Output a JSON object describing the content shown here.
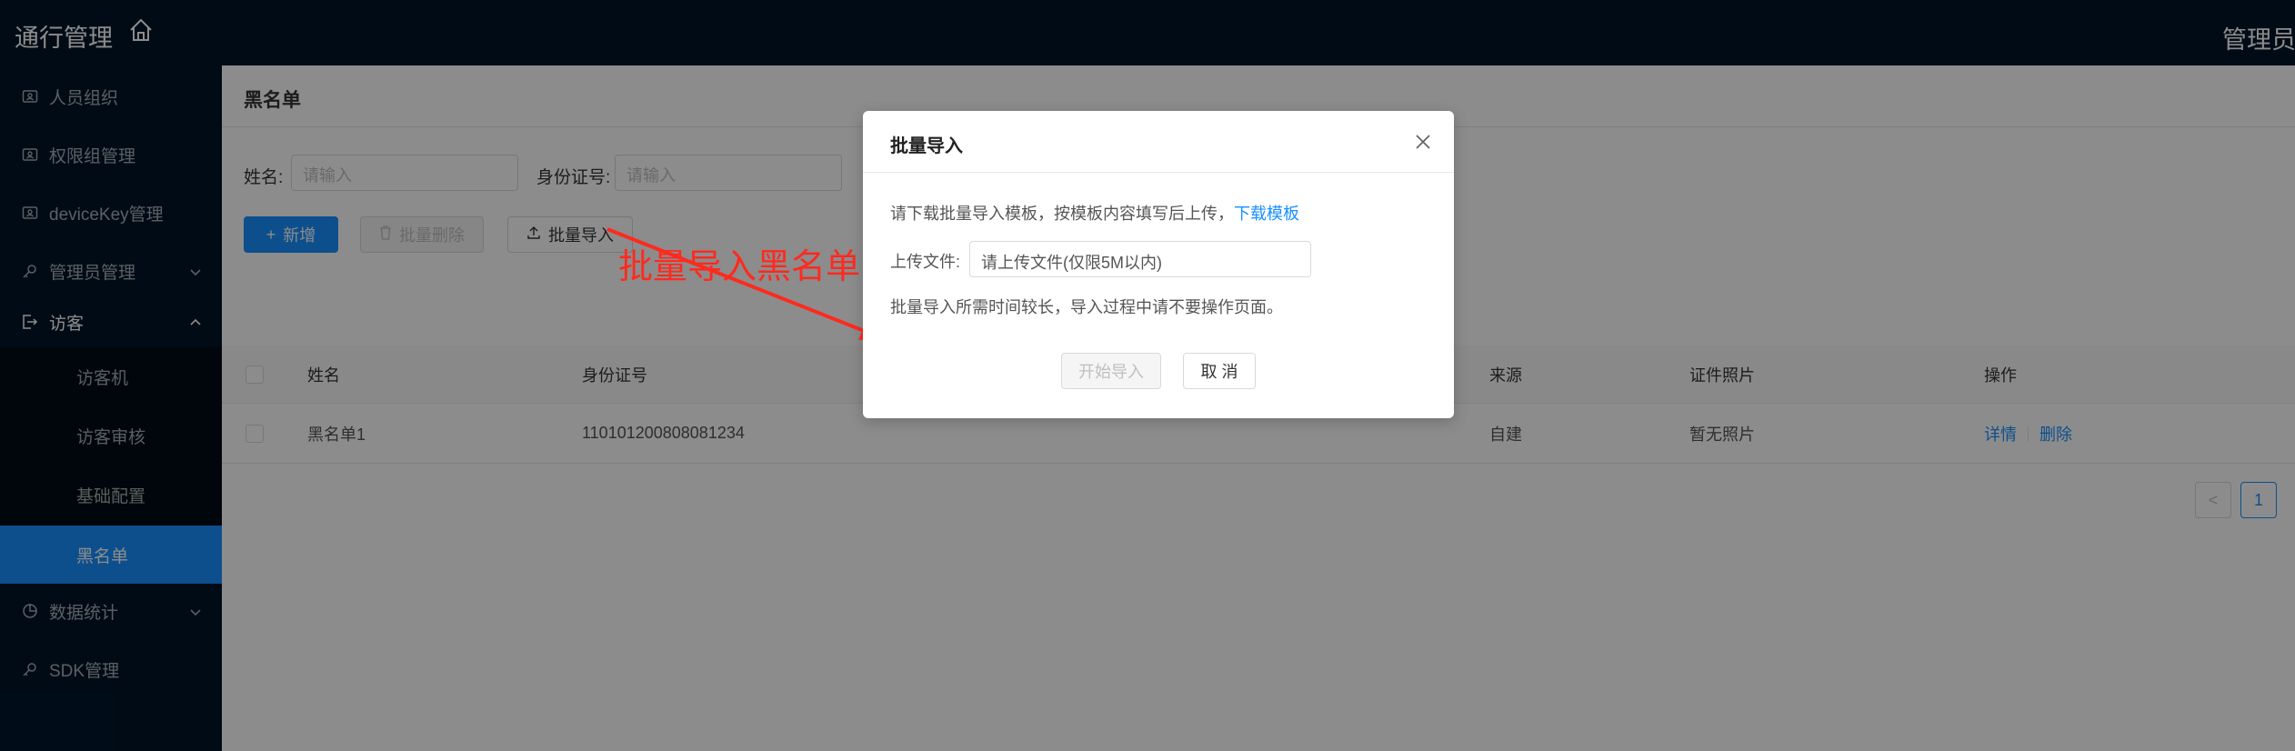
{
  "header": {
    "app_title": "通行管理",
    "user_label": "管理员"
  },
  "sidebar": {
    "items": [
      {
        "label": "人员组织",
        "icon": "id-card-icon"
      },
      {
        "label": "权限组管理",
        "icon": "id-card-icon"
      },
      {
        "label": "deviceKey管理",
        "icon": "id-card-icon"
      },
      {
        "label": "管理员管理",
        "icon": "key-icon"
      },
      {
        "label": "访客",
        "icon": "logout-icon"
      },
      {
        "label": "数据统计",
        "icon": "pie-chart-icon"
      },
      {
        "label": "SDK管理",
        "icon": "key-icon"
      }
    ],
    "sub_items": [
      {
        "label": "访客机"
      },
      {
        "label": "访客审核"
      },
      {
        "label": "基础配置"
      },
      {
        "label": "黑名单"
      }
    ]
  },
  "page": {
    "title": "黑名单",
    "filters": {
      "name_label": "姓名:",
      "name_placeholder": "请输入",
      "id_label": "身份证号:",
      "id_placeholder": "请输入"
    },
    "toolbar": {
      "add_label": "新增",
      "batch_delete_label": "批量删除",
      "batch_import_label": "批量导入"
    },
    "table": {
      "columns": [
        "姓名",
        "身份证号",
        "来源",
        "证件照片",
        "操作"
      ],
      "rows": [
        {
          "name": "黑名单1",
          "id_number": "110101200808081234",
          "source": "自建",
          "photo": "暂无照片",
          "detail": "详情",
          "delete": "删除"
        }
      ]
    },
    "pagination": {
      "prev": "<",
      "current": "1"
    }
  },
  "annotation": {
    "text": "批量导入黑名单",
    "color": "#ff2a1f"
  },
  "modal": {
    "title": "批量导入",
    "instruction": "请下载批量导入模板，按模板内容填写后上传，",
    "download_link": "下载模板",
    "upload_label": "上传文件:",
    "upload_value": "请上传文件(仅限5M以内)",
    "note": "批量导入所需时间较长，导入过程中请不要操作页面。",
    "start_label": "开始导入",
    "cancel_label": "取 消"
  }
}
